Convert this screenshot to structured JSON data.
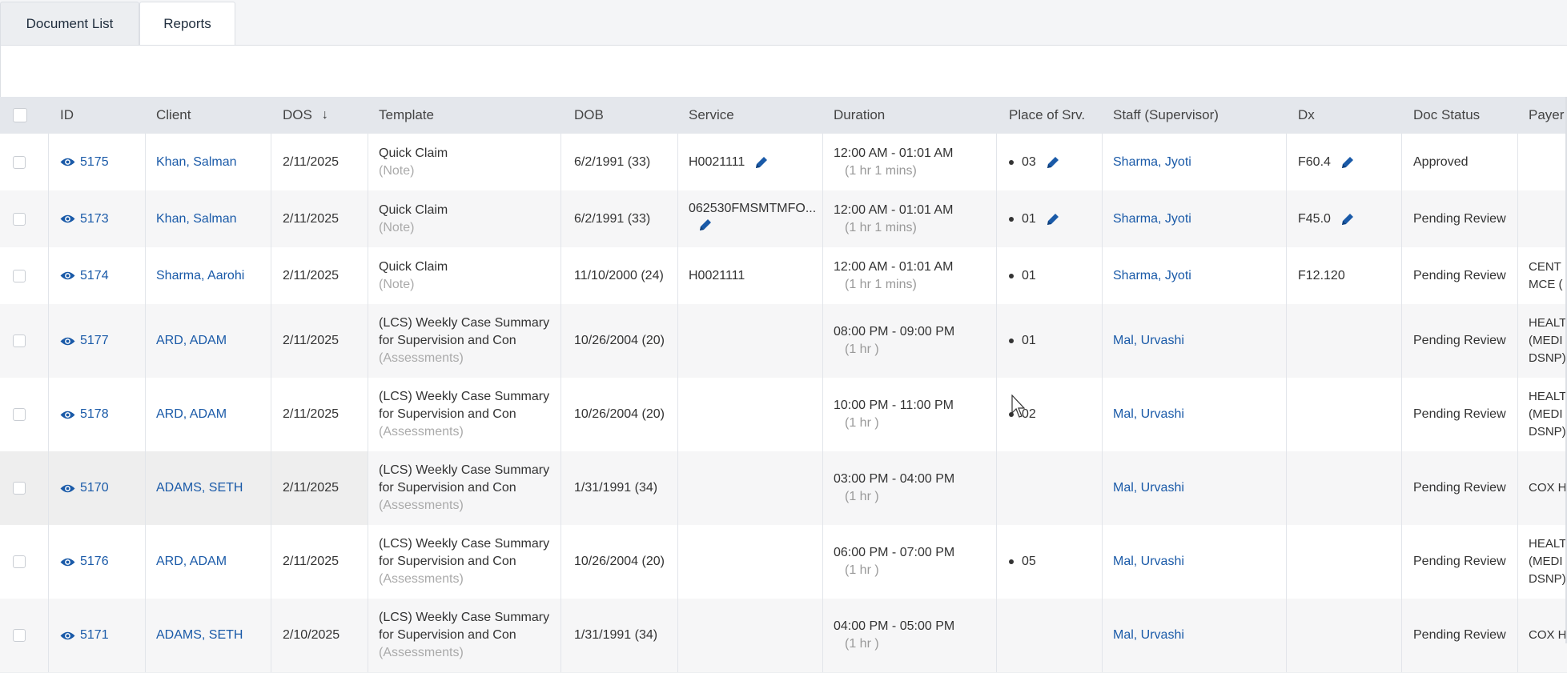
{
  "tabs": [
    {
      "label": "Document List",
      "active": false
    },
    {
      "label": "Reports",
      "active": true
    }
  ],
  "columns": [
    "ID",
    "Client",
    "DOS",
    "Template",
    "DOB",
    "Service",
    "Duration",
    "Place of Srv.",
    "Staff (Supervisor)",
    "Dx",
    "Doc Status",
    "Payer"
  ],
  "sort_indicator": "↓",
  "rows": [
    {
      "id": "5175",
      "client": "Khan, Salman",
      "dos": "2/11/2025",
      "template": "Quick Claim",
      "template_type": "(Note)",
      "dob": "6/2/1991 (33)",
      "service": "H0021111",
      "service_edit": true,
      "duration": "12:00 AM - 01:01 AM",
      "duration_len": "(1 hr 1 mins)",
      "place": "03",
      "place_edit": true,
      "staff": "Sharma, Jyoti",
      "dx": "F60.4",
      "dx_edit": true,
      "status": "Approved",
      "payer": ""
    },
    {
      "id": "5173",
      "client": "Khan, Salman",
      "dos": "2/11/2025",
      "template": "Quick Claim",
      "template_type": "(Note)",
      "dob": "6/2/1991 (33)",
      "service": "062530FMSMTMFO...",
      "service_edit": true,
      "duration": "12:00 AM - 01:01 AM",
      "duration_len": "(1 hr 1 mins)",
      "place": "01",
      "place_edit": true,
      "staff": "Sharma, Jyoti",
      "dx": "F45.0",
      "dx_edit": true,
      "status": "Pending Review",
      "payer": ""
    },
    {
      "id": "5174",
      "client": "Sharma, Aarohi",
      "dos": "2/11/2025",
      "template": "Quick Claim",
      "template_type": "(Note)",
      "dob": "11/10/2000 (24)",
      "service": "H0021111",
      "service_edit": false,
      "duration": "12:00 AM - 01:01 AM",
      "duration_len": "(1 hr 1 mins)",
      "place": "01",
      "place_edit": false,
      "staff": "Sharma, Jyoti",
      "dx": "F12.120",
      "dx_edit": false,
      "status": "Pending Review",
      "payer": "CENT\nMCE ("
    },
    {
      "id": "5177",
      "client": "ARD, ADAM",
      "dos": "2/11/2025",
      "template": "(LCS) Weekly Case Summary for Supervision and Con",
      "template_type": "(Assessments)",
      "dob": "10/26/2004 (20)",
      "service": "",
      "service_edit": false,
      "duration": "08:00 PM - 09:00 PM",
      "duration_len": "(1 hr )",
      "place": "01",
      "place_edit": false,
      "staff": "Mal, Urvashi",
      "dx": "",
      "dx_edit": false,
      "status": "Pending Review",
      "payer": "HEALT\n(MEDI\nDSNP)"
    },
    {
      "id": "5178",
      "client": "ARD, ADAM",
      "dos": "2/11/2025",
      "template": "(LCS) Weekly Case Summary for Supervision and Con",
      "template_type": "(Assessments)",
      "dob": "10/26/2004 (20)",
      "service": "",
      "service_edit": false,
      "duration": "10:00 PM - 11:00 PM",
      "duration_len": "(1 hr )",
      "place": "02",
      "place_edit": false,
      "staff": "Mal, Urvashi",
      "dx": "",
      "dx_edit": false,
      "status": "Pending Review",
      "payer": "HEALT\n(MEDI\nDSNP)"
    },
    {
      "id": "5170",
      "client": "ADAMS, SETH",
      "dos": "2/11/2025",
      "template": "(LCS) Weekly Case Summary for Supervision and Con",
      "template_type": "(Assessments)",
      "dob": "1/31/1991 (34)",
      "service": "",
      "service_edit": false,
      "duration": "03:00 PM - 04:00 PM",
      "duration_len": "(1 hr )",
      "place": "",
      "place_edit": false,
      "staff": "Mal, Urvashi",
      "dx": "",
      "dx_edit": false,
      "status": "Pending Review",
      "payer": "COX H"
    },
    {
      "id": "5176",
      "client": "ARD, ADAM",
      "dos": "2/11/2025",
      "template": "(LCS) Weekly Case Summary for Supervision and Con",
      "template_type": "(Assessments)",
      "dob": "10/26/2004 (20)",
      "service": "",
      "service_edit": false,
      "duration": "06:00 PM - 07:00 PM",
      "duration_len": "(1 hr )",
      "place": "05",
      "place_edit": false,
      "staff": "Mal, Urvashi",
      "dx": "",
      "dx_edit": false,
      "status": "Pending Review",
      "payer": "HEALT\n(MEDI\nDSNP)"
    },
    {
      "id": "5171",
      "client": "ADAMS, SETH",
      "dos": "2/10/2025",
      "template": "(LCS) Weekly Case Summary for Supervision and Con",
      "template_type": "(Assessments)",
      "dob": "1/31/1991 (34)",
      "service": "",
      "service_edit": false,
      "duration": "04:00 PM - 05:00 PM",
      "duration_len": "(1 hr )",
      "place": "",
      "place_edit": false,
      "staff": "Mal, Urvashi",
      "dx": "",
      "dx_edit": false,
      "status": "Pending Review",
      "payer": "COX H"
    }
  ],
  "colors": {
    "link": "#1a5aa8",
    "header_bg": "#e4e7ec",
    "muted": "#aaaaaa",
    "pencil": "#1a5aa8"
  }
}
